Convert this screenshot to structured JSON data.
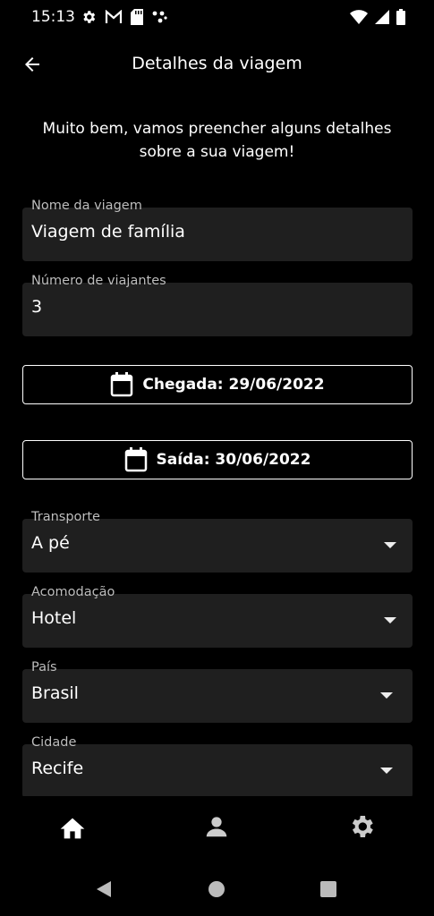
{
  "status_bar": {
    "time": "15:13",
    "left_icons": [
      "gear-icon",
      "gmail-icon",
      "sd-card-icon",
      "dots-icon"
    ],
    "right_icons": [
      "wifi-icon",
      "signal-icon",
      "battery-icon"
    ]
  },
  "app_bar": {
    "title": "Detalhes da viagem",
    "back_icon": "arrow-back-icon"
  },
  "intro_text": "Muito bem, vamos preencher alguns detalhes sobre a sua viagem!",
  "form": {
    "trip_name": {
      "label": "Nome da viagem",
      "value": "Viagem de família"
    },
    "travelers": {
      "label": "Número de viajantes",
      "value": "3"
    },
    "arrival": {
      "label": "Chegada: 29/06/2022",
      "icon": "calendar-icon"
    },
    "departure": {
      "label": "Saída: 30/06/2022",
      "icon": "calendar-icon"
    },
    "transport": {
      "label": "Transporte",
      "value": "A pé"
    },
    "accommodation": {
      "label": "Acomodação",
      "value": "Hotel"
    },
    "country": {
      "label": "País",
      "value": "Brasil"
    },
    "city": {
      "label": "Cidade",
      "value": "Recife"
    }
  },
  "bottom_nav": {
    "items": [
      "home-icon",
      "person-icon",
      "settings-icon"
    ],
    "active": "home-icon"
  },
  "system_nav": [
    "back-triangle-icon",
    "home-circle-icon",
    "recents-square-icon"
  ],
  "colors": {
    "background": "#000000",
    "field_background": "#1f1f1f",
    "text": "#ffffff",
    "label": "#bdbdbd"
  }
}
